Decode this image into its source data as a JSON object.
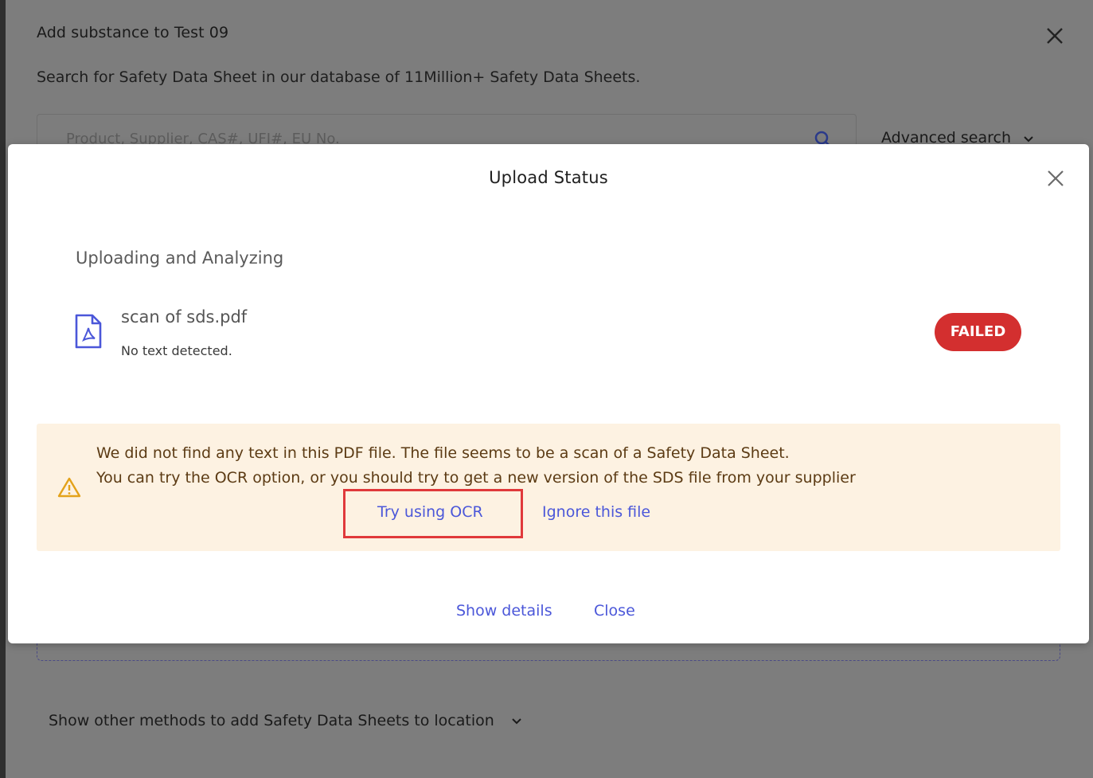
{
  "background_dialog": {
    "title": "Add substance to Test 09",
    "subtitle": "Search for Safety Data Sheet in our database of 11Million+ Safety Data Sheets.",
    "search_placeholder": "Product, Supplier, CAS#, UFI#, EU No.",
    "advanced_search_label": "Advanced search",
    "other_methods_label": "Show other methods to add Safety Data Sheets to location"
  },
  "modal": {
    "title": "Upload Status",
    "section_title": "Uploading and Analyzing",
    "file": {
      "name": "scan of sds.pdf",
      "note": "No text detected.",
      "status": "FAILED"
    },
    "warning": {
      "line1": "We did not find any text in this PDF file. The file seems to be a scan of a Safety Data Sheet.",
      "line2": "You can try the OCR option, or you should try to get a new version of the SDS file from your supplier",
      "ocr_link": "Try using OCR",
      "ignore_link": "Ignore this file"
    },
    "footer": {
      "show_details": "Show details",
      "close": "Close"
    }
  },
  "colors": {
    "link": "#4b57d9",
    "failed_badge": "#d32f2f",
    "warning_bg": "#fdf2e2",
    "warning_text": "#5c3b14",
    "highlight": "#e0393b",
    "pdf_icon": "#4b57d9"
  },
  "icons": {
    "close": "close-icon",
    "search": "search-icon",
    "chevron": "chevron-down-icon",
    "file": "pdf-file-icon",
    "warning": "warning-icon"
  }
}
